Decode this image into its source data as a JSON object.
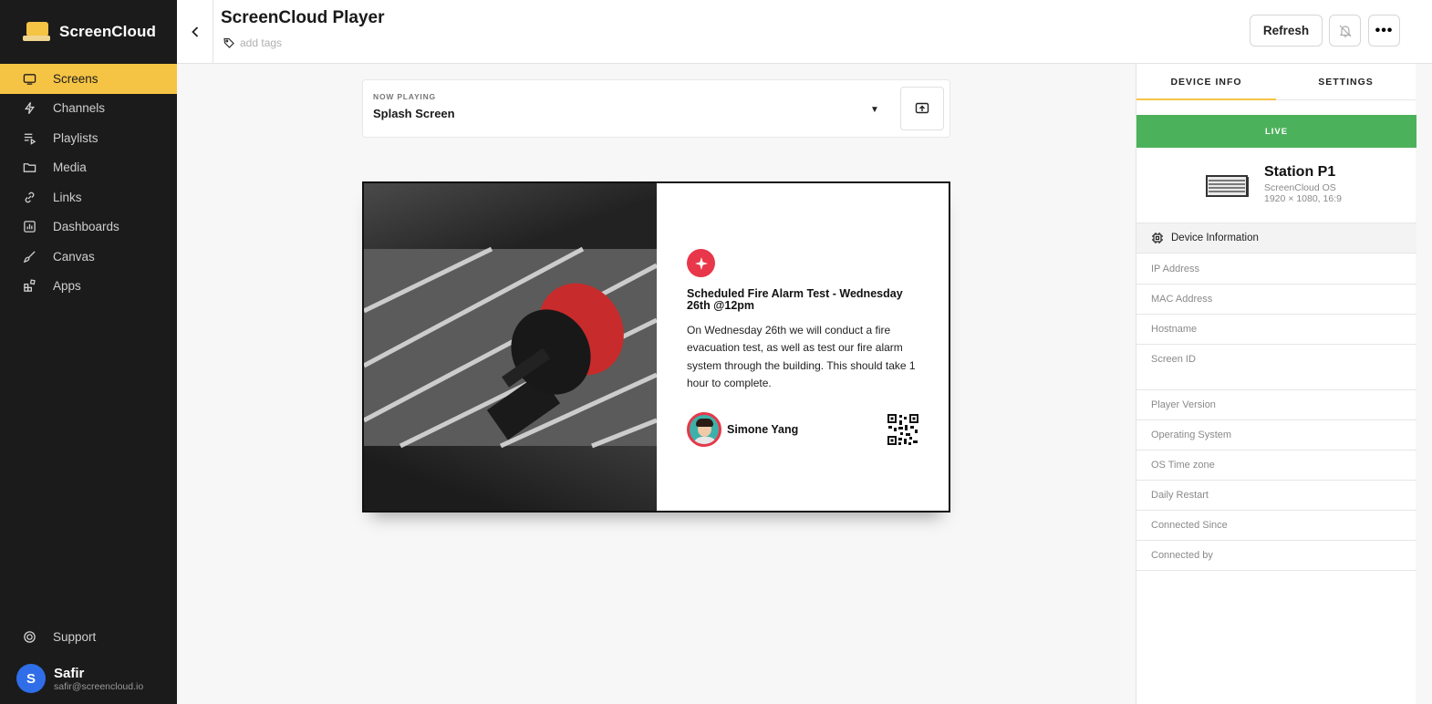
{
  "brand": {
    "name": "ScreenCloud"
  },
  "sidebar": {
    "items": [
      {
        "label": "Screens",
        "icon": "monitor-icon",
        "active": true
      },
      {
        "label": "Channels",
        "icon": "bolt-icon"
      },
      {
        "label": "Playlists",
        "icon": "playlist-icon"
      },
      {
        "label": "Media",
        "icon": "folder-icon"
      },
      {
        "label": "Links",
        "icon": "link-icon"
      },
      {
        "label": "Dashboards",
        "icon": "dashboard-icon"
      },
      {
        "label": "Canvas",
        "icon": "brush-icon"
      },
      {
        "label": "Apps",
        "icon": "apps-icon"
      }
    ],
    "support": "Support",
    "user": {
      "initial": "S",
      "name": "Safir",
      "email": "safir@screencloud.io"
    }
  },
  "header": {
    "title": "ScreenCloud Player",
    "tags_placeholder": "add tags",
    "refresh_label": "Refresh",
    "more_label": "•••"
  },
  "now_playing": {
    "label": "NOW PLAYING",
    "value": "Splash Screen"
  },
  "preview": {
    "title": "Scheduled Fire Alarm Test - Wednesday 26th @12pm",
    "body": "On Wednesday 26th we will conduct a fire evacuation test, as well as test our fire alarm system through the building.  This should take 1 hour to complete.",
    "author": "Simone Yang"
  },
  "panel": {
    "tabs": [
      "DEVICE INFO",
      "SETTINGS"
    ],
    "status": "LIVE",
    "device": {
      "name": "Station P1",
      "os": "ScreenCloud OS",
      "resolution": "1920 × 1080, 16:9"
    },
    "section": "Device Information",
    "fields": [
      "IP Address",
      "MAC Address",
      "Hostname",
      "Screen ID",
      "Player Version",
      "Operating System",
      "OS Time zone",
      "Daily Restart",
      "Connected Since",
      "Connected by"
    ]
  },
  "colors": {
    "accent": "#f6c445",
    "live": "#4cb15b",
    "sidebar_bg": "#1b1b1b",
    "alert": "#e8374a"
  }
}
